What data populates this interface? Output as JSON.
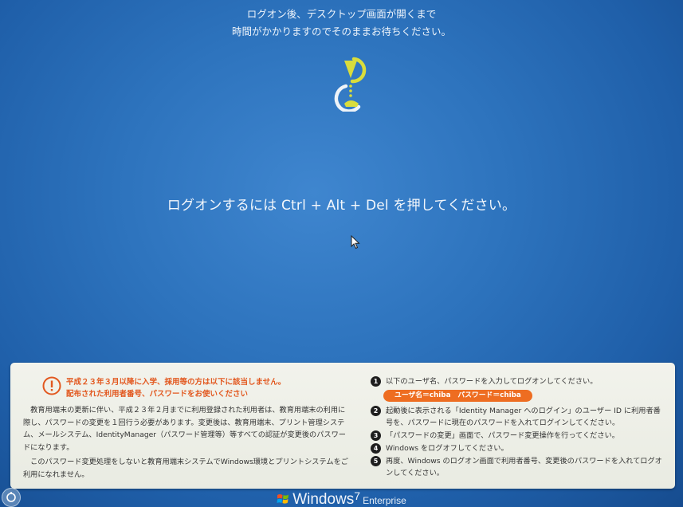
{
  "top_message": {
    "line1": "ログオン後、デスクトップ画面が開くまで",
    "line2": "時間がかかりますのでそのままお待ちください。"
  },
  "logon_prompt": "ログオンするには Ctrl + Alt + Del を押してください。",
  "notice": {
    "heading_line1": "平成２３年３月以降に入学、採用等の方は以下に該当しません。",
    "heading_line2": "配布された利用者番号、パスワードをお使いください",
    "body_para1": "　教育用端末の更新に伴い、平成２３年２月までに利用登録された利用者は、教育用端末の利用に際し、パスワードの変更を１回行う必要があります。変更後は、教育用端末、プリント管理システム、メールシステム、IdentityManager（パスワード管理等）等すべての認証が変更後のパスワードになります。",
    "body_para2": "　このパスワード変更処理をしないと教育用端末システムでWindows環境とプリントシステムをご利用になれません。",
    "steps": [
      {
        "num": "1",
        "text": "以下のユーザ名、パスワードを入力してログオンしてください。"
      },
      {
        "num": "2",
        "text": "起動後に表示される「Identity Manager へのログイン」のユーザー ID に利用者番号を、パスワードに現在のパスワードを入れてログインしてください。"
      },
      {
        "num": "3",
        "text": "「パスワードの変更」画面で、パスワード変更操作を行ってください。"
      },
      {
        "num": "4",
        "text": "Windows をログオフしてください。"
      },
      {
        "num": "5",
        "text": "再度、Windows のログオン画面で利用者番号、変更後のパスワードを入れてログオンしてください。"
      }
    ],
    "credentials_badge": "ユーザ名＝chiba　パスワード＝chiba"
  },
  "branding": {
    "windows": "Windows",
    "version": "7",
    "edition": "Enterprise"
  },
  "colors": {
    "background": "#2d73bd",
    "panel": "#eeefe7",
    "warning": "#e2581f",
    "badge": "#ee6d21",
    "hourglass": "#d9dd3c"
  },
  "icons": [
    "hourglass-icon",
    "warning-icon",
    "mouse-cursor-icon",
    "ease-of-access-icon",
    "windows-flag-icon"
  ]
}
